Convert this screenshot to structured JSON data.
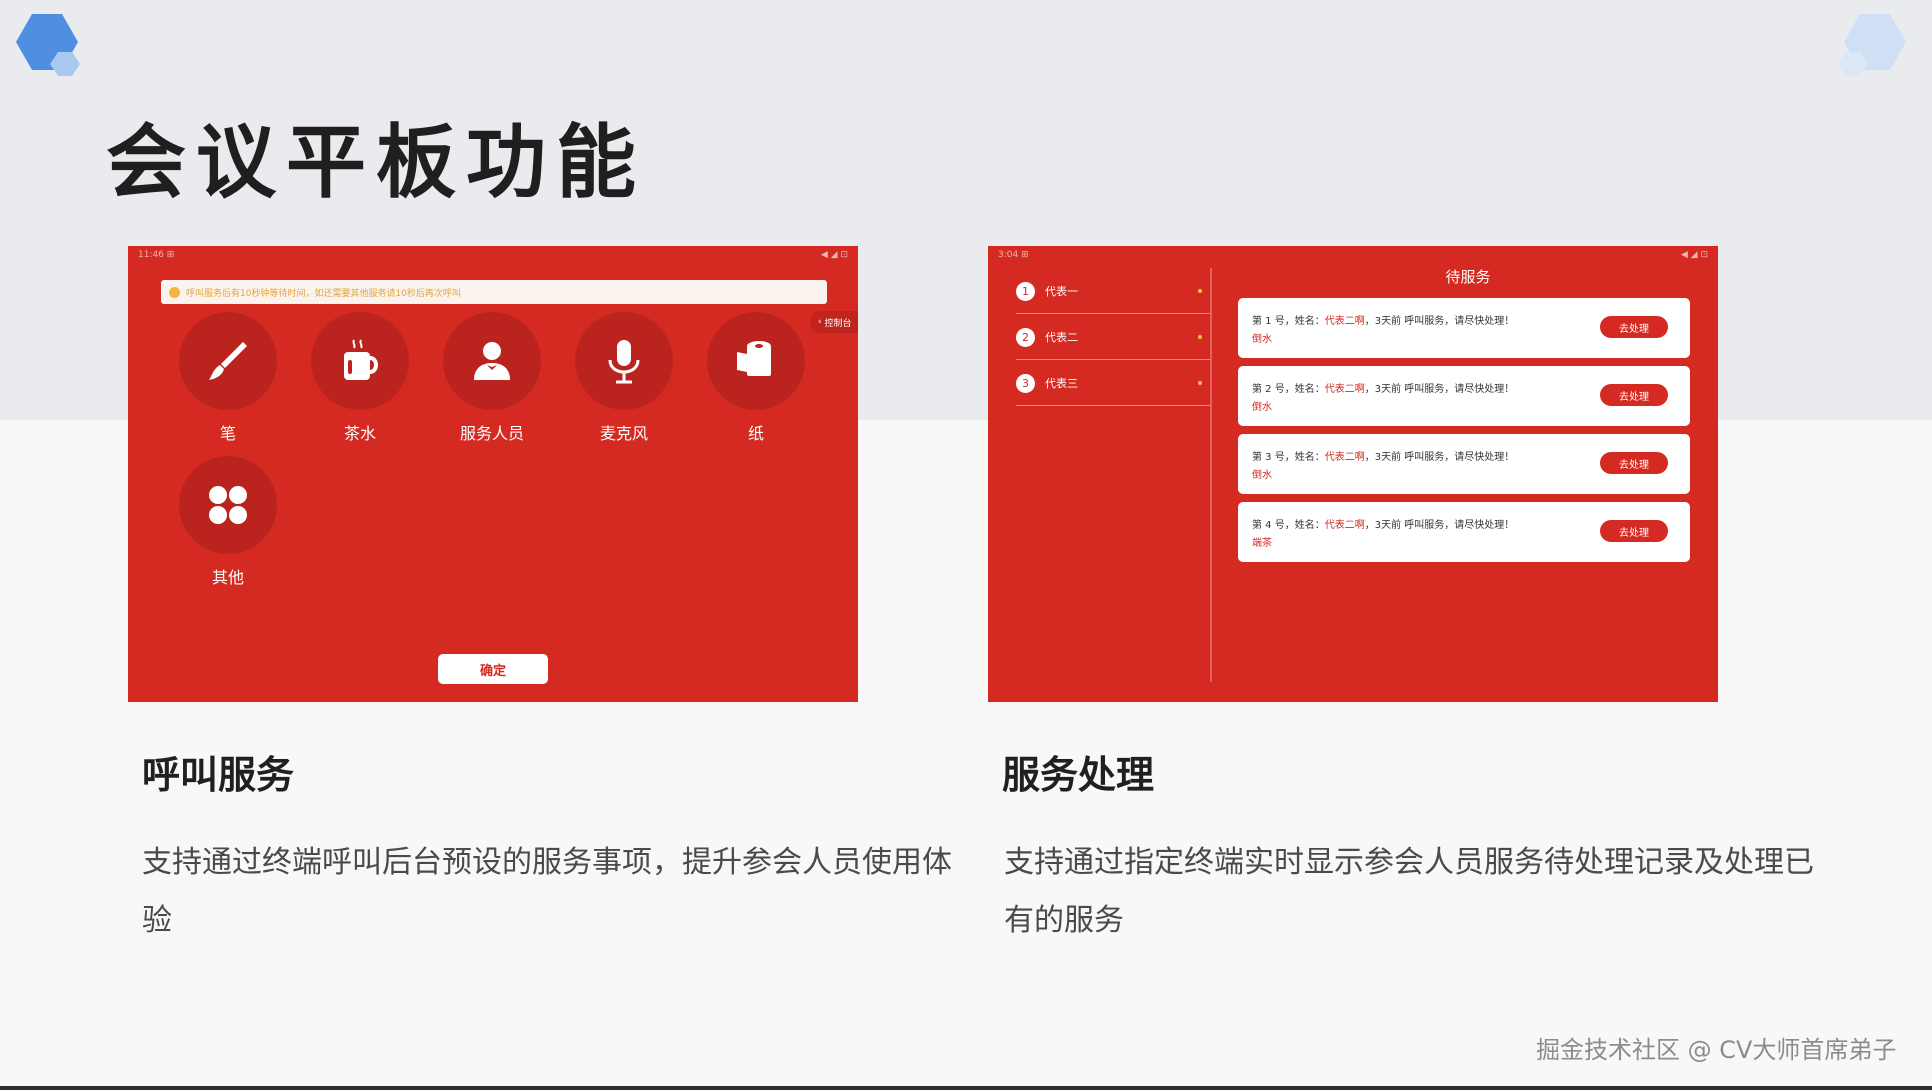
{
  "slide": {
    "title": "会议平板功能",
    "watermark": "掘金技术社区 @ CV大师首席弟子",
    "colors": {
      "accent": "#d42a22",
      "background": "#f8f8f9",
      "band": "#e9ebee"
    }
  },
  "call_panel": {
    "status_time": "11:46 ⊞",
    "status_right": "◀ ◢ ⊡",
    "notice": "呼叫服务后有10秒钟等待时间，如还需要其他服务请10秒后再次呼叫",
    "side_tab": "控制台",
    "services": [
      {
        "label": "笔",
        "icon": "brush-icon"
      },
      {
        "label": "茶水",
        "icon": "tea-cup-icon"
      },
      {
        "label": "服务人员",
        "icon": "waiter-icon"
      },
      {
        "label": "麦克风",
        "icon": "microphone-icon"
      },
      {
        "label": "纸",
        "icon": "paper-roll-icon"
      },
      {
        "label": "其他",
        "icon": "grid-icon"
      }
    ],
    "confirm": "确定",
    "caption_title": "呼叫服务",
    "caption_text": "支持通过终端呼叫后台预设的服务事项，提升参会人员使用体验"
  },
  "service_panel": {
    "status_time": "3:04 ⊞",
    "status_right": "◀ ◢ ⊡",
    "pending_title": "待服务",
    "representatives": [
      {
        "num": "1",
        "name": "代表一"
      },
      {
        "num": "2",
        "name": "代表二"
      },
      {
        "num": "3",
        "name": "代表三"
      }
    ],
    "requests": [
      {
        "prefix": "第 1 号，姓名：",
        "name": "代表二啊",
        "suffix": "，3天前 呼叫服务，请尽快处理！",
        "item": "倒水",
        "action": "去处理"
      },
      {
        "prefix": "第 2 号，姓名：",
        "name": "代表二啊",
        "suffix": "，3天前 呼叫服务，请尽快处理！",
        "item": "倒水",
        "action": "去处理"
      },
      {
        "prefix": "第 3 号，姓名：",
        "name": "代表二啊",
        "suffix": "，3天前 呼叫服务，请尽快处理！",
        "item": "倒水",
        "action": "去处理"
      },
      {
        "prefix": "第 4 号，姓名：",
        "name": "代表二啊",
        "suffix": "，3天前 呼叫服务，请尽快处理！",
        "item": "端茶",
        "action": "去处理"
      }
    ],
    "caption_title": "服务处理",
    "caption_text": "支持通过指定终端实时显示参会人员服务待处理记录及处理已有的服务"
  }
}
